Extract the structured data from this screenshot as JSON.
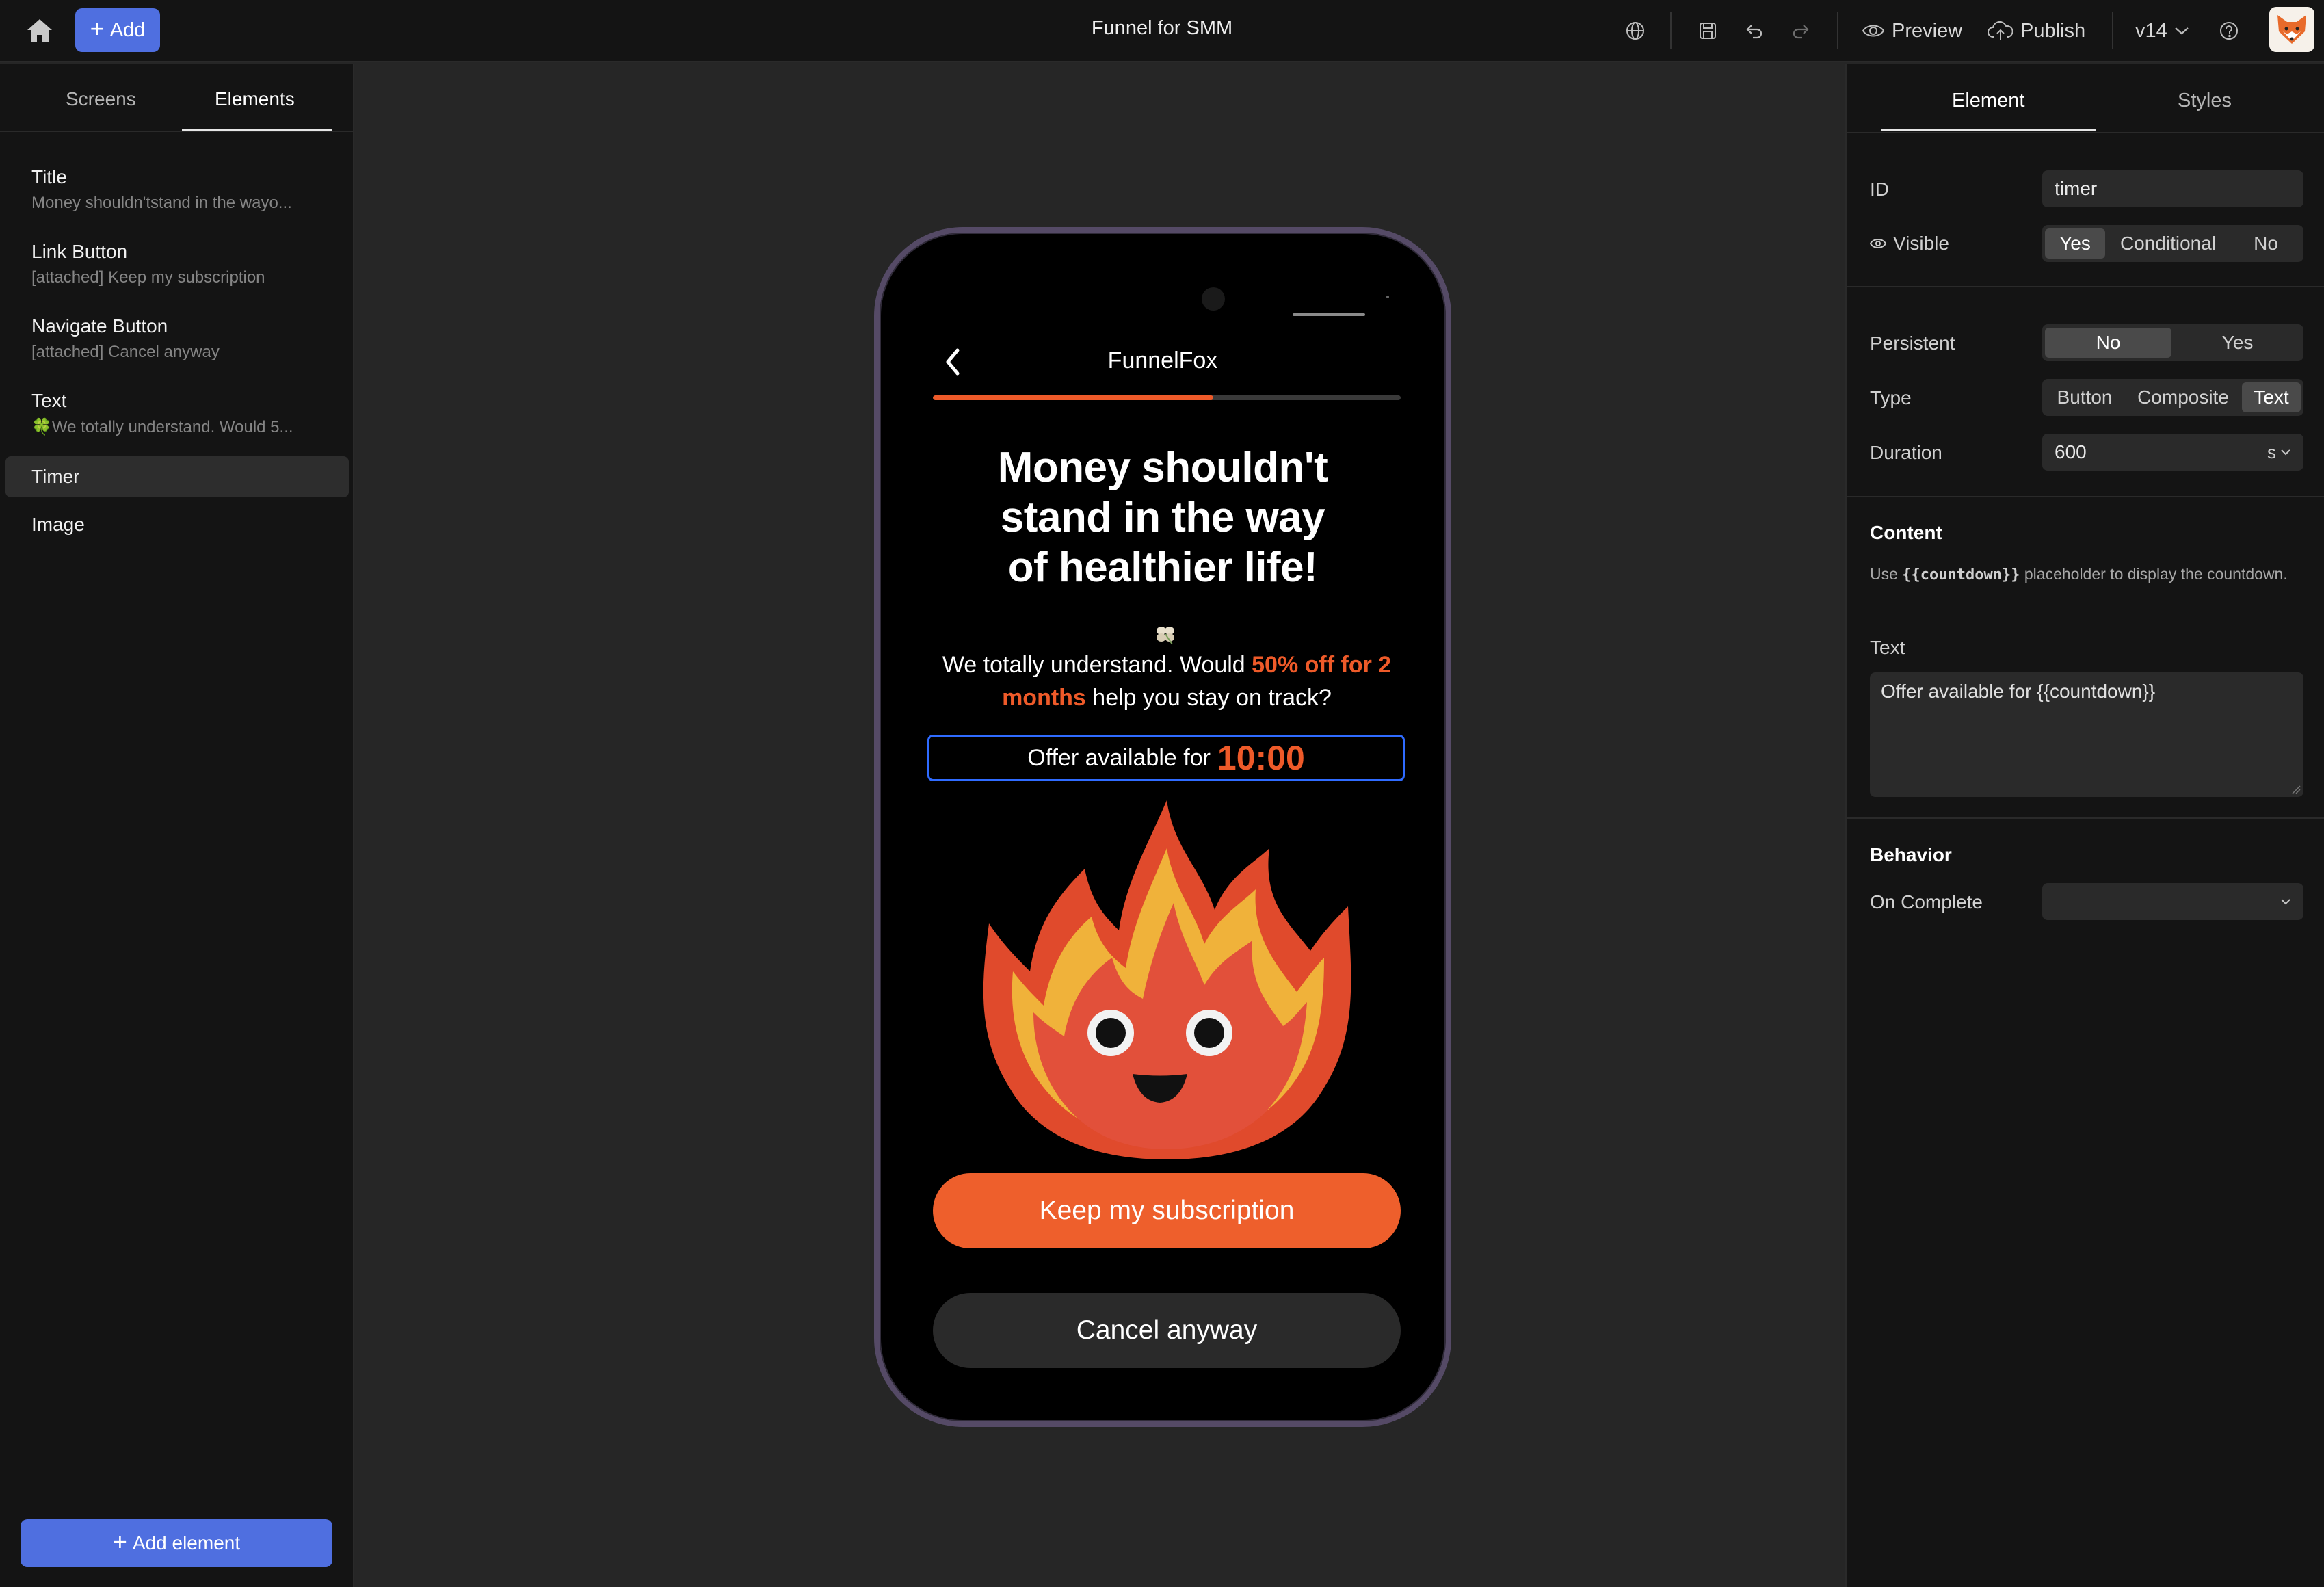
{
  "topbar": {
    "add_label": "Add",
    "title": "Funnel for SMM",
    "preview_label": "Preview",
    "publish_label": "Publish",
    "version_label": "v14"
  },
  "left_panel": {
    "tabs": [
      "Screens",
      "Elements"
    ],
    "active_tab": "Elements",
    "elements": [
      {
        "title": "Title",
        "subtitle": "Money shouldn'tstand in the wayo..."
      },
      {
        "title": "Link Button",
        "subtitle": "[attached] Keep my subscription"
      },
      {
        "title": "Navigate Button",
        "subtitle": "[attached] Cancel anyway"
      },
      {
        "title": "Text",
        "subtitle": "🍀We totally understand. Would 5..."
      },
      {
        "title": "Timer",
        "subtitle": ""
      },
      {
        "title": "Image",
        "subtitle": ""
      }
    ],
    "selected_element": "Timer",
    "add_element_label": "Add element"
  },
  "phone": {
    "header_title": "FunnelFox",
    "progress_fraction": 0.6,
    "headline": "Money shouldn't stand in the way of healthier life!",
    "headline_lines": [
      "Money shouldn't",
      "stand in the way",
      "of healthier life!"
    ],
    "body_pre": "We totally understand. Would ",
    "body_highlight": "50% off for 2 months",
    "body_post": " help you stay on track?",
    "timer_label": "Offer available for",
    "timer_value": "10:00",
    "primary_button": "Keep my subscription",
    "secondary_button": "Cancel anyway",
    "accent_color": "#ee5a29",
    "timer_border_color": "#2f6bff"
  },
  "right_panel": {
    "tabs": [
      "Element",
      "Styles"
    ],
    "active_tab": "Element",
    "id_label": "ID",
    "id_value": "timer",
    "visible_label": "Visible",
    "visible_options": [
      "Yes",
      "Conditional",
      "No"
    ],
    "visible_selected": "Yes",
    "persistent_label": "Persistent",
    "persistent_options": [
      "No",
      "Yes"
    ],
    "persistent_selected": "No",
    "type_label": "Type",
    "type_options": [
      "Button",
      "Composite",
      "Text"
    ],
    "type_selected": "Text",
    "duration_label": "Duration",
    "duration_value": "600",
    "duration_unit": "s",
    "content_heading": "Content",
    "help_pre": "Use ",
    "help_code": "{{countdown}}",
    "help_post": " placeholder to display the countdown.",
    "text_label": "Text",
    "text_value": "Offer available for {{countdown}}",
    "behavior_heading": "Behavior",
    "on_complete_label": "On Complete",
    "on_complete_value": ""
  }
}
